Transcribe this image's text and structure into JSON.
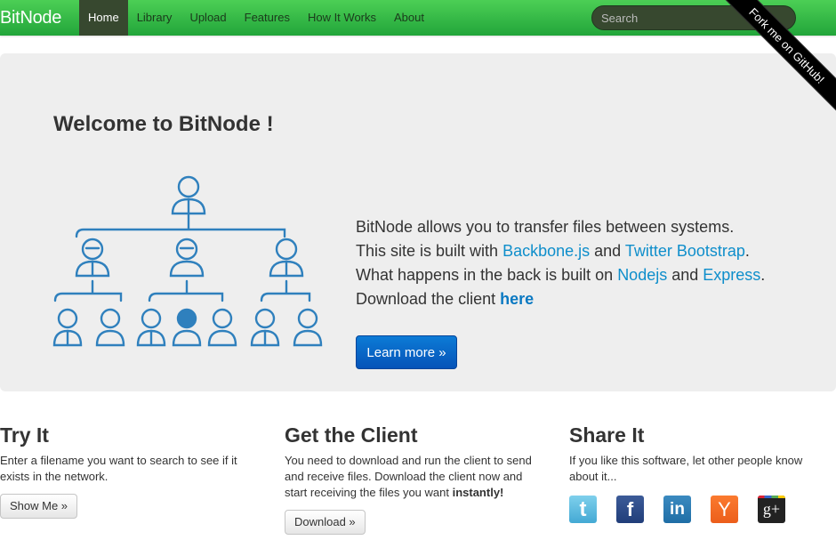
{
  "navbar": {
    "brand": "BitNode",
    "items": [
      {
        "label": "Home",
        "active": true
      },
      {
        "label": "Library"
      },
      {
        "label": "Upload"
      },
      {
        "label": "Features"
      },
      {
        "label": "How It Works"
      },
      {
        "label": "About"
      }
    ],
    "search_placeholder": "Search",
    "ribbon": "Fork me on GitHub!"
  },
  "hero": {
    "title": "Welcome to BitNode !",
    "line1": "BitNode allows you to transfer files between systems.",
    "line2_prefix": "This site is built with ",
    "line2_link1": "Backbone.js",
    "line2_mid": " and ",
    "line2_link2": "Twitter Bootstrap",
    "line2_suffix": ".",
    "line3_prefix": "What happens in the back is built on ",
    "line3_link1": "Nodejs",
    "line3_mid": " and ",
    "line3_link2": "Express",
    "line3_suffix": ".",
    "line4_prefix": "Download the client ",
    "line4_link": "here",
    "button": "Learn more »",
    "illustration": "org-chart-icon"
  },
  "columns": [
    {
      "title": "Try It",
      "text": "Enter a filename you want to search to see if it exists in the network.",
      "button": "Show Me »"
    },
    {
      "title": "Get the Client",
      "text": "You need to download and run the client to send and receive files. Download the client now and start receiving the files you want ",
      "text_bold": "instantly!",
      "button": "Download »"
    },
    {
      "title": "Share It",
      "text": "If you like this software, let other people know about it...",
      "social": [
        {
          "name": "twitter-icon",
          "glyph": "t"
        },
        {
          "name": "facebook-icon",
          "glyph": "f"
        },
        {
          "name": "linkedin-icon",
          "glyph": "in"
        },
        {
          "name": "hackernews-icon",
          "glyph": "Y"
        },
        {
          "name": "googleplus-icon",
          "glyph": "g+"
        }
      ]
    }
  ],
  "colors": {
    "nav_green": "#34bb48",
    "nav_active": "#37482f",
    "link": "#0e8ecb",
    "primary_button": "#0663c6",
    "hero_bg": "#eeeeee"
  }
}
